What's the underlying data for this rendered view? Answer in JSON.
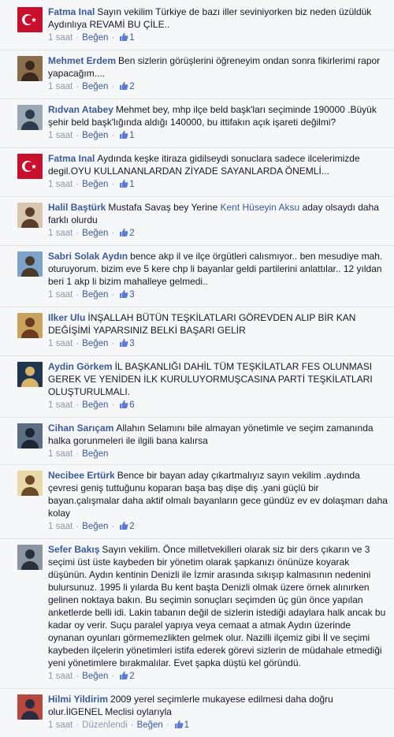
{
  "comments": [
    {
      "name": "Fatma Inal",
      "text": "Sayın vekilim Türkiye de bazı iller seviniyorken biz neden üzüldük Aydınlıya REVAMİ BU ÇİLE..",
      "time": "1 saat",
      "like_label": "Beğen",
      "likes": "1",
      "avatar": {
        "type": "flag",
        "bg": "#c8102e"
      }
    },
    {
      "name": "Mehmet Erdem",
      "text": "Ben sizlerin görüşlerini öğreneyim ondan sonra fikirlerimi rapor yapacağım....",
      "time": "1 saat",
      "like_label": "Beğen",
      "likes": "2",
      "avatar": {
        "type": "person",
        "bg": "#8a6d4b",
        "fg": "#3a2a1c"
      }
    },
    {
      "name": "Rıdvan Atabey",
      "text": "Mehmet bey, mhp ilçe beld başk'ları seçiminde 190000 .Büyük şehir beld başk'lığında aldığı 140000, bu ittifakın açık işareti değilmi?",
      "time": "1 saat",
      "like_label": "Beğen",
      "likes": "1",
      "avatar": {
        "type": "person",
        "bg": "#9aa8b5",
        "fg": "#2e3b4e"
      }
    },
    {
      "name": "Fatma Inal",
      "text": "Aydında keşke itiraza gidilseydi sonuclara sadece ilcelerimizde degil.OYU KULLANANLARDAN ZİYADE SAYANLARDA ÖNEMLİ...",
      "time": "1 saat",
      "like_label": "Beğen",
      "likes": "1",
      "avatar": {
        "type": "flag",
        "bg": "#c8102e"
      }
    },
    {
      "name": "Halil Baştürk",
      "text_before": "Mustafa Savaş bey Yerine",
      "mention": "Kent Hüseyin Aksu",
      "text_after": "aday olsaydı daha farklı olurdu",
      "time": "1 saat",
      "like_label": "Beğen",
      "likes": "2",
      "avatar": {
        "type": "person",
        "bg": "#d9c6b0",
        "fg": "#5a3e2b"
      }
    },
    {
      "name": "Sabri Solak Aydın",
      "text": "bence akp il ve ilçe örgütleri calısmıyor.. ben mesudiye mah. oturuyorum. bizim eve 5 kere chp li bayanlar geldi partilerini anlattılar.. 12 yıldan beri 1 akp li bizim mahalleye gelmedi..",
      "time": "1 saat",
      "like_label": "Beğen",
      "likes": "3",
      "avatar": {
        "type": "person",
        "bg": "#7ea3c9",
        "fg": "#4a3a2a"
      }
    },
    {
      "name": "Ilker Ulu",
      "text": "İNŞALLAH BÜTÜN TEŞKİLATLARI GÖREVDEN ALIP BİR KAN DEĞİŞİMİ YAPARSINIZ BELKİ BAŞARI GELİR",
      "time": "1 saat",
      "like_label": "Beğen",
      "likes": "3",
      "avatar": {
        "type": "person",
        "bg": "#c9a25e",
        "fg": "#6b3b1f"
      }
    },
    {
      "name": "Aydin Görkem",
      "text": "İL BAŞKANLIĞI DAHİL TÜM TEŞKİLATLAR FES OLUNMASI GEREK VE YENİDEN İLK KURULUYORMUŞCASINA PARTİ TEŞKİLATLARI OLUŞTURULMALI.",
      "time": "1 saat",
      "like_label": "Beğen",
      "likes": "6",
      "avatar": {
        "type": "person",
        "bg": "#1f3550",
        "fg": "#d8b46a"
      }
    },
    {
      "name": "Cihan Sarıçam",
      "text": "Allahın Selamını bile almayan yönetimle ve seçim zamanında halka gorunmeleri ile ilgili bana kalırsa",
      "time": "1 saat",
      "like_label": "Beğen",
      "likes": "",
      "avatar": {
        "type": "person",
        "bg": "#5d6e82",
        "fg": "#1d2733"
      }
    },
    {
      "name": "Necibee Ertürk",
      "text": "Bence bir bayan aday çıkartmalıyız sayın vekilim .aydında çevresi geniş tuttuğunu koparan başa baş dişe diş .yani güçlü bir bayan.çalışmalar daha aktif olmalı bayanların gece gündüz ev ev dolaşmarı daha kolay",
      "time": "1 saat",
      "like_label": "Beğen",
      "likes": "2",
      "avatar": {
        "type": "person",
        "bg": "#e8d9a8",
        "fg": "#6b4a2a"
      }
    },
    {
      "name": "Sefer Bakış",
      "text": "Sayın vekilim. Önce milletvekilleri olarak siz bir ders çıkarın ve 3 seçimi üst üste kaybeden bir yönetim olarak şapkanızı önünüze koyarak düşünün. Aydın kentinin Denizli ile İzmir arasında sıkışıp kalmasının nedenini bulursunuz. 1995 li yılarda Bu kent başta Denizli olmak üzere örnek alınırken gelinen noktaya bakın. Bu seçimin sonuçları seçimden üç gün önce yapılan anketlerde belli idi. Lakin tabanın değil de sizlerin istediği adaylara halk ancak bu kadar oy verir. Suçu paralel yapıya veya cemaat a atmak Aydın üzerinde oynanan oyunları görmemezlikten gelmek olur. Nazilli ilçemiz gibi İl ve seçimi kaybeden ilçelerin yönetimleri istifa ederek görevi sizlerin de müdahale etmediği yeni yönetimlere bırakmalılar. Evet şapka düştü kel göründü.",
      "time": "1 saat",
      "like_label": "Beğen",
      "likes": "2",
      "avatar": {
        "type": "person",
        "bg": "#8c96a2",
        "fg": "#2b3038"
      }
    },
    {
      "name": "Hilmi Yildirim",
      "text": "2009 yerel seçimlerle mukayese edilmesi daha doğru olur.İlGENEL Meclisi oylarıyla",
      "time": "1 saat",
      "edited_label": "Düzenlendi",
      "like_label": "Beğen",
      "likes": "1",
      "avatar": {
        "type": "person",
        "bg": "#b8473d",
        "fg": "#2a2a40"
      }
    }
  ],
  "colors": {
    "link": "#3b5998",
    "meta": "#9197a3",
    "text": "#141823",
    "background": "#f6f7f9"
  }
}
